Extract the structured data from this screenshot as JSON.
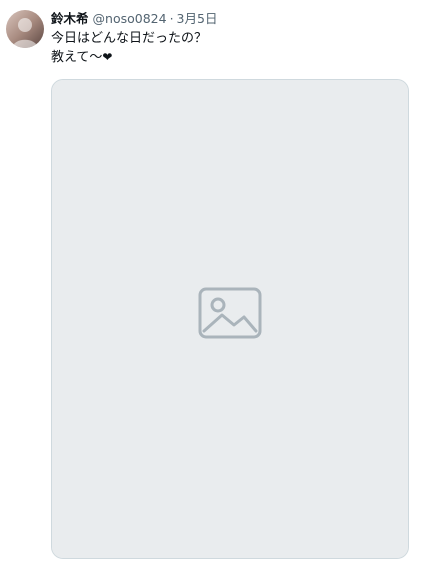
{
  "tweet": {
    "display_name": "鈴木希",
    "handle": "@noso0824",
    "separator": "·",
    "date": "3月5日",
    "text_line1": "今日はどんな日だったの？",
    "text_line2": "教えて〜",
    "heart": "❤"
  },
  "media": {
    "icon": "image-placeholder-icon"
  },
  "avatar": {
    "icon": "avatar-placeholder-icon"
  },
  "colors": {
    "text_primary": "#0f1419",
    "text_secondary": "#536471",
    "border": "#cfd9de",
    "media_background": "#e9ecee"
  }
}
